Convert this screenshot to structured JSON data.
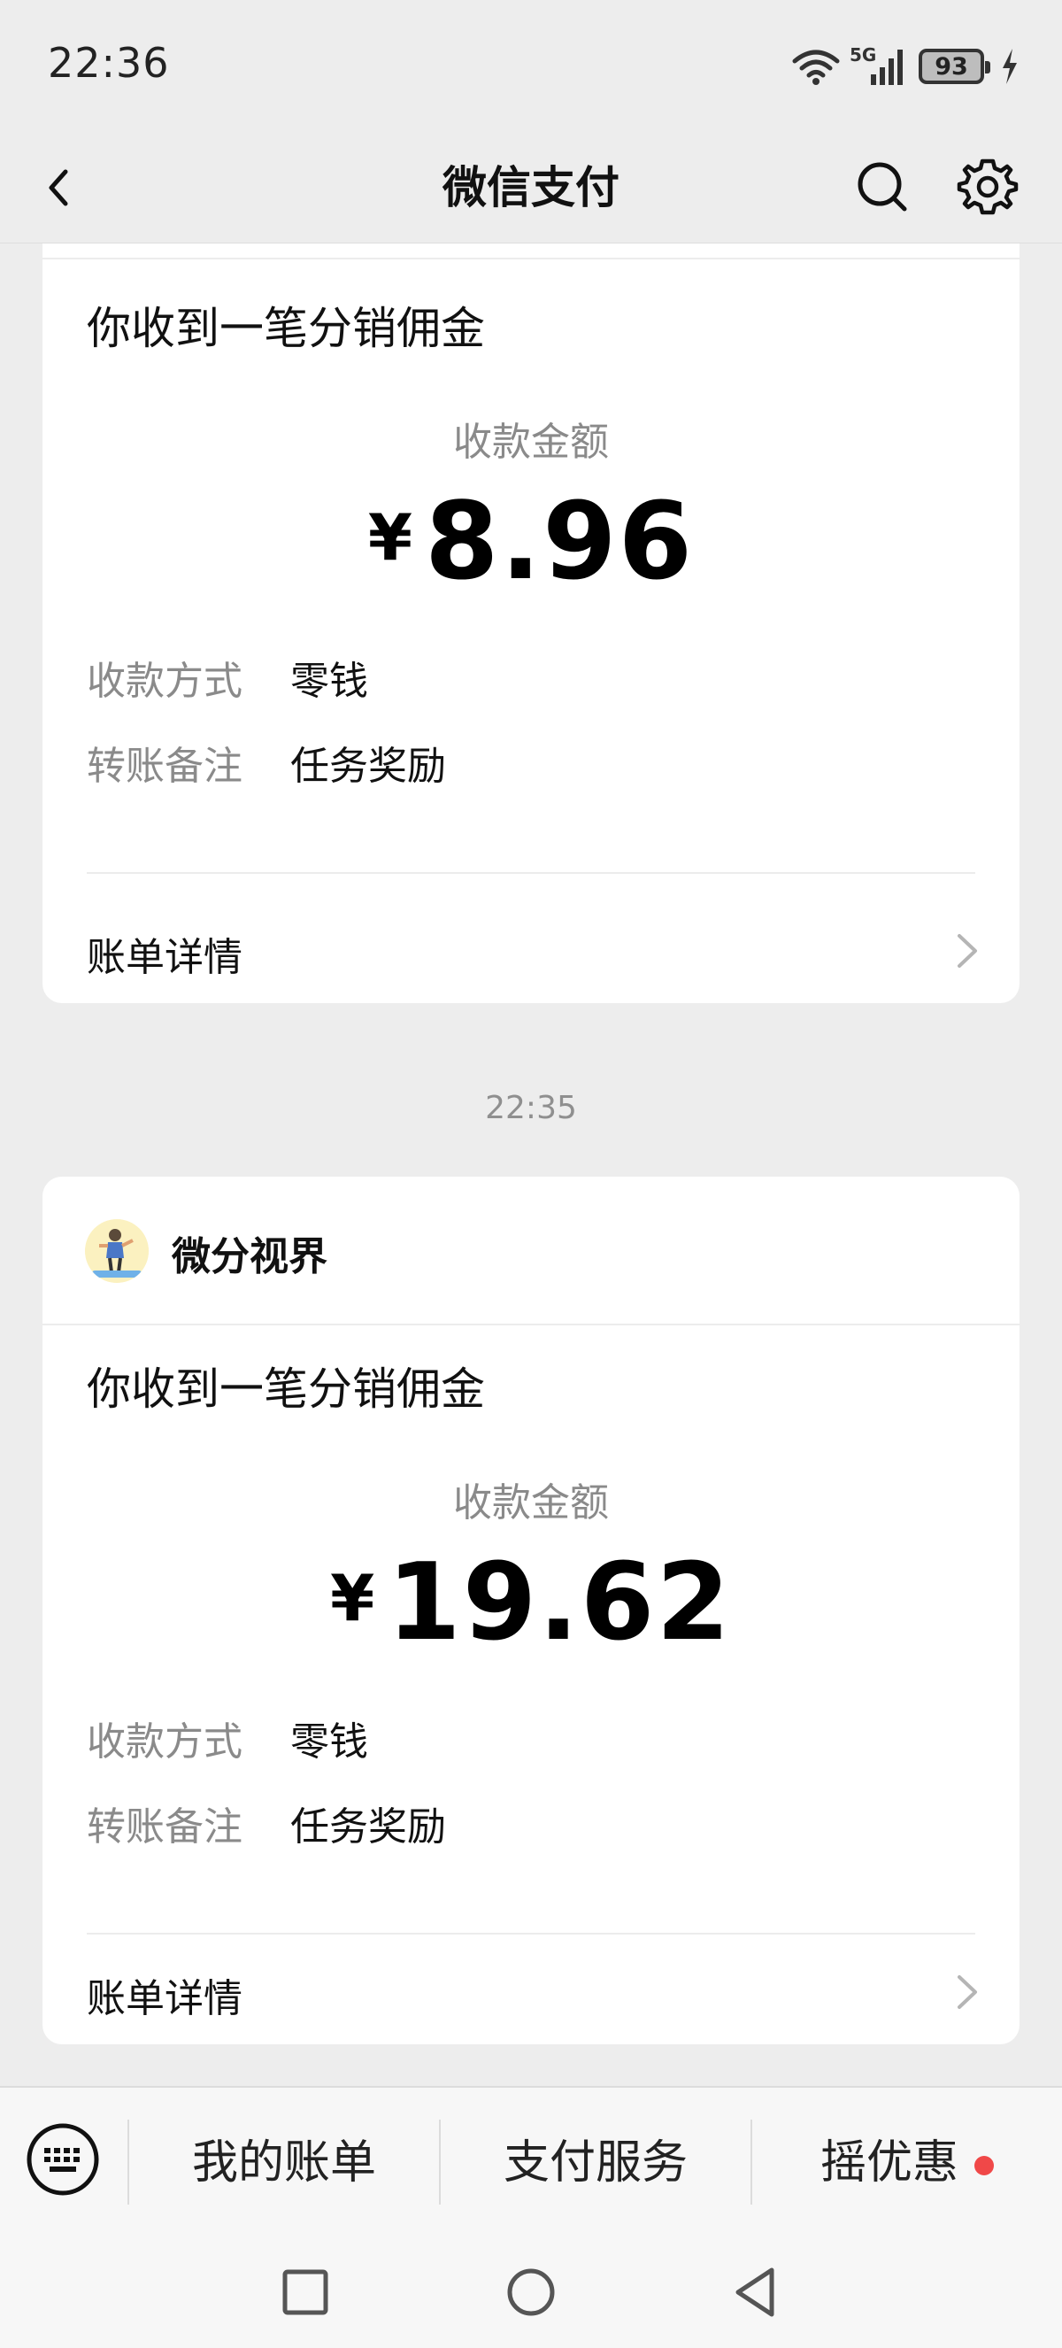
{
  "status_bar": {
    "time": "22:36",
    "network": "5G",
    "battery": "93"
  },
  "nav": {
    "title": "微信支付"
  },
  "cards": [
    {
      "title": "你收到一笔分销佣金",
      "amount_label": "收款金额",
      "currency": "¥",
      "amount": "8.96",
      "rows": [
        {
          "label": "收款方式",
          "value": "零钱"
        },
        {
          "label": "转账备注",
          "value": "任务奖励"
        }
      ],
      "detail_label": "账单详情"
    },
    {
      "merchant": "微分视界",
      "title": "你收到一笔分销佣金",
      "amount_label": "收款金额",
      "currency": "¥",
      "amount": "19.62",
      "rows": [
        {
          "label": "收款方式",
          "value": "零钱"
        },
        {
          "label": "转账备注",
          "value": "任务奖励"
        }
      ],
      "detail_label": "账单详情"
    }
  ],
  "time_divider": "22:35",
  "bottom_menu": {
    "items": [
      {
        "label": "我的账单"
      },
      {
        "label": "支付服务"
      },
      {
        "label": "摇优惠",
        "has_dot": true
      }
    ]
  },
  "colors": {
    "background": "#ededed",
    "card": "#ffffff",
    "secondary_text": "#8a8a8a",
    "notification_dot": "#f04848"
  },
  "icons": [
    "wifi-icon",
    "cellular-signal-icon",
    "battery-icon",
    "charging-icon",
    "back-icon",
    "search-icon",
    "gear-icon",
    "chevron-right-icon",
    "keyboard-icon",
    "recent-apps-icon",
    "home-icon",
    "back-triangle-icon"
  ]
}
